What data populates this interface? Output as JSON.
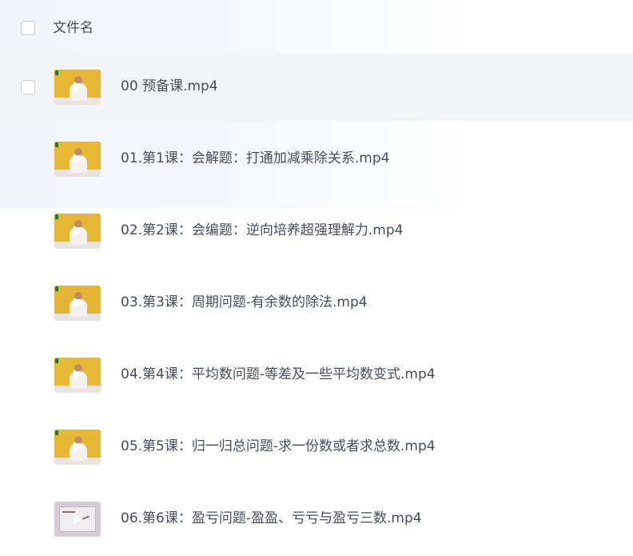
{
  "header": {
    "column_label": "文件名"
  },
  "files": [
    {
      "name": "00 预备课.mp4",
      "thumb": "video-thumbnail"
    },
    {
      "name": "01.第1课：会解题：打通加减乘除关系.mp4",
      "thumb": "video-thumbnail"
    },
    {
      "name": "02.第2课：会编题：逆向培养超强理解力.mp4",
      "thumb": "video-thumbnail"
    },
    {
      "name": "03.第3课：周期问题-有余数的除法.mp4",
      "thumb": "video-thumbnail"
    },
    {
      "name": "04.第4课：平均数问题-等差及一些平均数变式.mp4",
      "thumb": "video-thumbnail"
    },
    {
      "name": "05.第5课：归一归总问题-求一份数或者求总数.mp4",
      "thumb": "video-thumbnail"
    },
    {
      "name": "06.第6课：盈亏问题-盈盈、亏亏与盈亏三数.mp4",
      "thumb": "whiteboard-video-thumbnail"
    }
  ],
  "colors": {
    "hover_row": "#f3f4f6",
    "thumb_wall": "#e6b733",
    "play_button": "#ffffff",
    "text": "#454d5a"
  }
}
